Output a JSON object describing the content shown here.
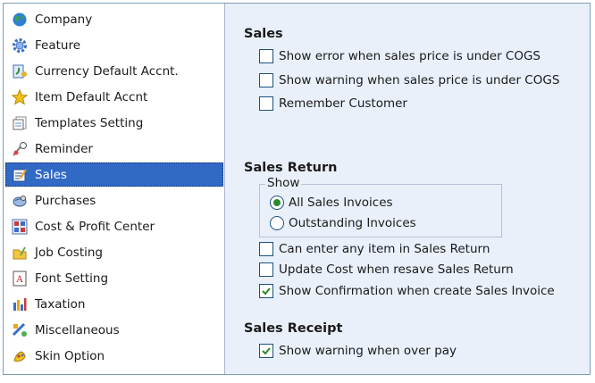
{
  "sidebar": {
    "items": [
      {
        "label": "Company",
        "icon": "globe-icon"
      },
      {
        "label": "Feature",
        "icon": "gear-icon"
      },
      {
        "label": "Currency Default Accnt.",
        "icon": "currency-icon"
      },
      {
        "label": "Item Default Accnt",
        "icon": "star-icon"
      },
      {
        "label": "Templates Setting",
        "icon": "templates-icon"
      },
      {
        "label": "Reminder",
        "icon": "reminder-icon"
      },
      {
        "label": "Sales",
        "icon": "sales-icon",
        "selected": true
      },
      {
        "label": "Purchases",
        "icon": "purchases-icon"
      },
      {
        "label": "Cost & Profit Center",
        "icon": "grid-icon"
      },
      {
        "label": "Job Costing",
        "icon": "job-costing-icon"
      },
      {
        "label": "Font Setting",
        "icon": "font-icon"
      },
      {
        "label": "Taxation",
        "icon": "taxation-icon"
      },
      {
        "label": "Miscellaneous",
        "icon": "miscellaneous-icon"
      },
      {
        "label": "Skin Option",
        "icon": "skin-icon"
      }
    ]
  },
  "sales": {
    "title": "Sales",
    "options": [
      {
        "label": "Show error when sales price is under COGS",
        "checked": false
      },
      {
        "label": "Show warning when sales price is under COGS",
        "checked": false
      },
      {
        "label": "Remember Customer",
        "checked": false
      }
    ]
  },
  "sales_return": {
    "title": "Sales Return",
    "show_group": {
      "legend": "Show",
      "options": [
        {
          "label": "All Sales Invoices",
          "selected": true
        },
        {
          "label": "Outstanding Invoices",
          "selected": false
        }
      ]
    },
    "options": [
      {
        "label": "Can enter any item in Sales Return",
        "checked": false
      },
      {
        "label": "Update Cost when resave Sales Return",
        "checked": false
      },
      {
        "label": "Show Confirmation when create Sales Invoice",
        "checked": true
      }
    ]
  },
  "sales_receipt": {
    "title": "Sales Receipt",
    "options": [
      {
        "label": "Show warning when over pay",
        "checked": true
      }
    ]
  },
  "colors": {
    "selection": "#316ac5",
    "panel_bg": "#e9f0fa",
    "check_mark": "#2a8a2a"
  }
}
